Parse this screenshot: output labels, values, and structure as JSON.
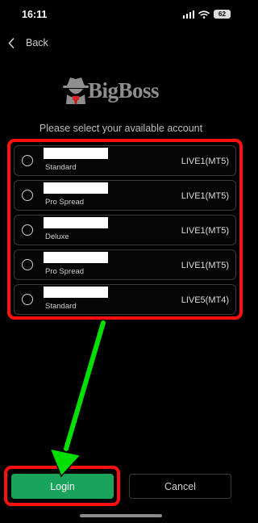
{
  "status_bar": {
    "time": "16:11",
    "battery": "62"
  },
  "nav": {
    "back_label": "Back"
  },
  "logo": {
    "text": "BigBoss"
  },
  "prompt": "Please select your available account",
  "accounts": [
    {
      "type": "Standard",
      "server": "LIVE1(MT5)"
    },
    {
      "type": "Pro Spread",
      "server": "LIVE1(MT5)"
    },
    {
      "type": "Deluxe",
      "server": "LIVE1(MT5)"
    },
    {
      "type": "Pro Spread",
      "server": "LIVE1(MT5)"
    },
    {
      "type": "Standard",
      "server": "LIVE5(MT4)"
    }
  ],
  "buttons": {
    "login": "Login",
    "cancel": "Cancel"
  },
  "colors": {
    "accent_green": "#1aa35a",
    "highlight_red": "#ff1010",
    "arrow_green": "#00e000"
  }
}
